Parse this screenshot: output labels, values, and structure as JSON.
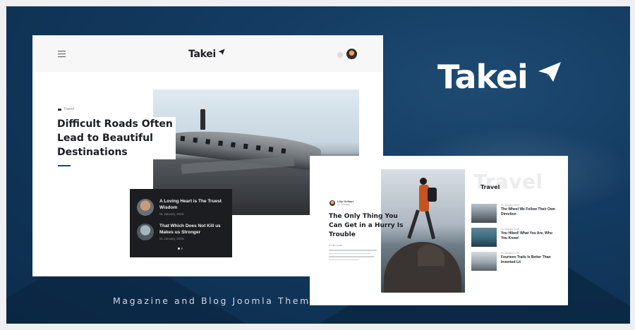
{
  "brand": {
    "name": "Takei"
  },
  "tagline": "Magazine and Blog Joomla Theme",
  "mockup_home": {
    "logo": "Takei",
    "category": "Travel",
    "headline": "Difficult Roads Often Lead to Beautiful Destinations",
    "featured_list": [
      {
        "title": "A Loving Heart is The Truest Wisdom",
        "date": "01 January, 2019"
      },
      {
        "title": "That Which Does Not Kill us Makes us Stronger",
        "date": "01 January, 2019"
      }
    ]
  },
  "mockup_category": {
    "author": "Lilly Gelbart",
    "author_date": "01 January",
    "headline": "The Only Thing You Can Get in a Hurry Is Trouble",
    "read_time": "2 min read",
    "watermark": "Travel",
    "label": "Travel",
    "posts": [
      {
        "date": "01 January 2019",
        "title": "The Wheel We Follow Their Own Direction"
      },
      {
        "date": "01 January 2019",
        "title": "You Hiked! What You Are, Who You Know!"
      },
      {
        "date": "01 January 2019",
        "title": "Fourteen Trails Is Better Than Invented Lit"
      }
    ]
  },
  "colors": {
    "banner_background": "#133a60",
    "accent": "#253e8a"
  }
}
